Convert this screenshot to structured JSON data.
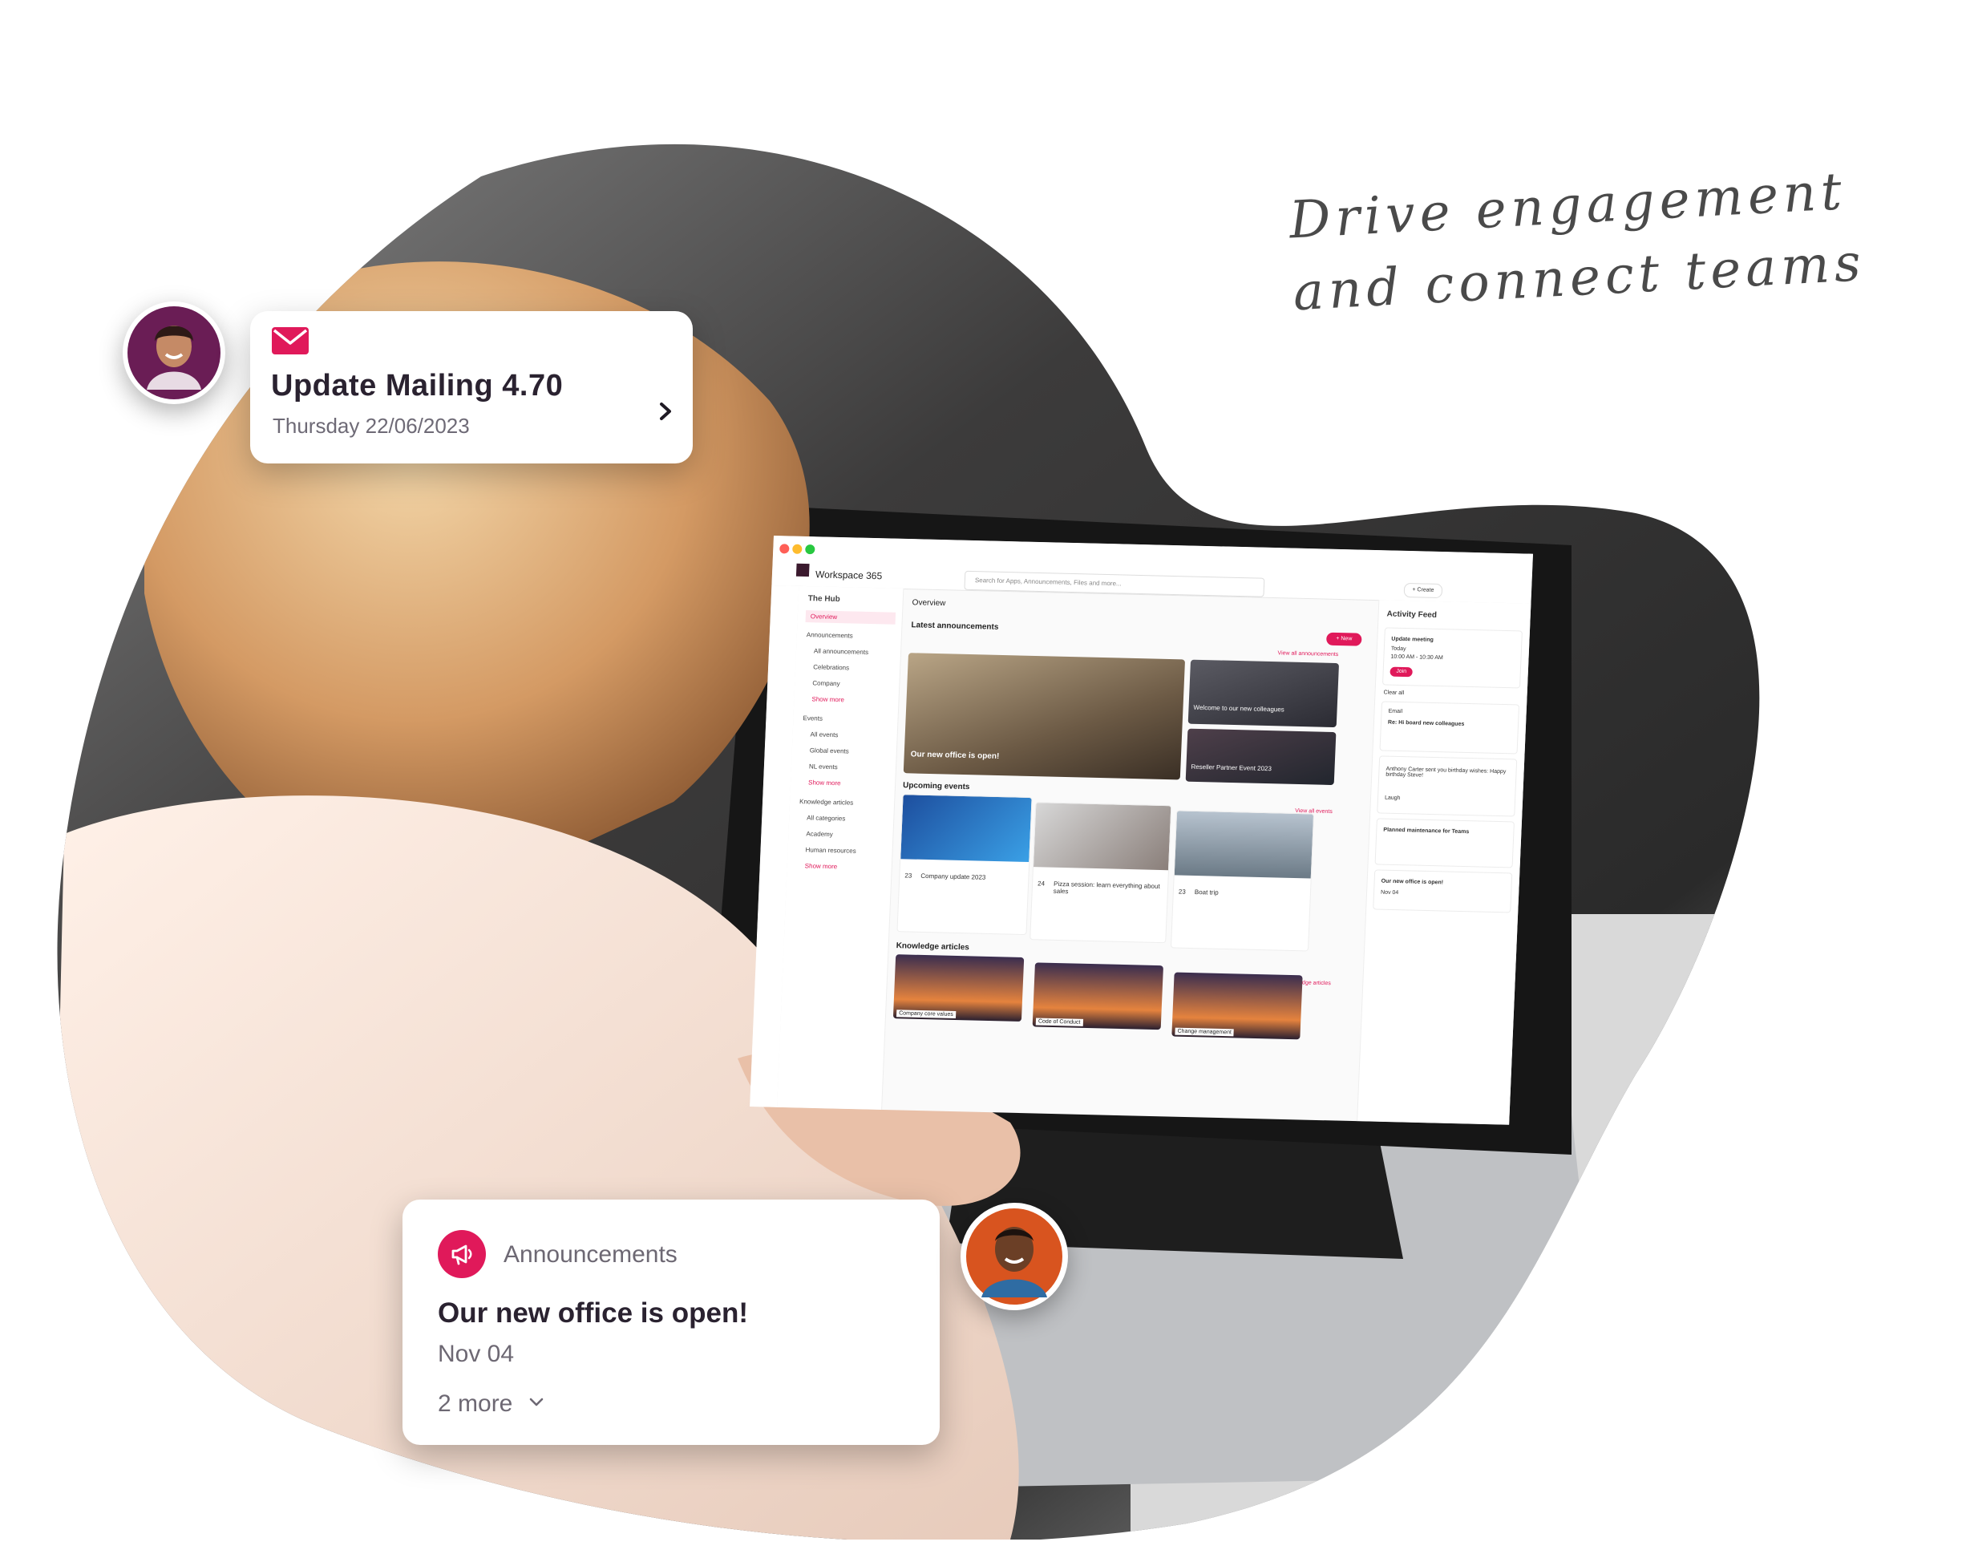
{
  "tagline": "Drive engagement and connect teams",
  "mailing_card": {
    "icon": "mail-icon",
    "title": "Update Mailing 4.70",
    "date": "Thursday 22/06/2023",
    "chevron_icon": "chevron-right-icon"
  },
  "announce_card": {
    "icon": "megaphone-icon",
    "category": "Announcements",
    "headline": "Our new office is open!",
    "date": "Nov 04",
    "more": "2 more"
  },
  "app": {
    "title": "Workspace 365",
    "search_placeholder": "Search for Apps, Announcements, Files and more...",
    "create": "+ Create",
    "nav": {
      "hub": "The Hub",
      "overview": "Overview",
      "announcements": "Announcements",
      "all_announcements": "All announcements",
      "celebrations": "Celebrations",
      "company": "Company",
      "show_more": "Show more",
      "events": "Events",
      "all_events": "All events",
      "global_events": "Global events",
      "nl_events": "NL events",
      "knowledge": "Knowledge articles",
      "all_categories": "All categories",
      "academy": "Academy",
      "human_resources": "Human resources"
    },
    "main": {
      "overview": "Overview",
      "latest": "Latest announcements",
      "new": "+ New",
      "view_all_ann": "View all announcements",
      "hero": "Our new office is open!",
      "welcome": "Welcome to our new colleagues",
      "partner": "Reseller Partner Event 2023",
      "upcoming": "Upcoming events",
      "view_all_events": "View all events",
      "events": [
        {
          "title": "Company update 2023",
          "day": "23"
        },
        {
          "title": "Pizza session: learn everything about sales",
          "day": "24"
        },
        {
          "title": "Boat trip",
          "day": "23"
        }
      ],
      "knowledge": "Knowledge articles",
      "view_all_knowledge": "View all knowledge articles",
      "articles": [
        "Company core values",
        "Code of Conduct",
        "Change management"
      ]
    },
    "feed": {
      "title": "Activity Feed",
      "meeting": "Update meeting",
      "meeting_when": "Today",
      "meeting_time": "10:00 AM - 10:30 AM",
      "join": "Join",
      "clear": "Clear all",
      "email": "Email",
      "email_subject": "Re: Hi board new colleagues",
      "birthday": "Anthony Carter sent you birthday wishes: Happy birthday Steve!",
      "laugh": "Laugh",
      "maintenance": "Planned maintenance for Teams",
      "ann": "Our new office is open!",
      "ann_date": "Nov 04"
    }
  },
  "colors": {
    "accent": "#e0195a",
    "card_text": "#2a2230",
    "muted": "#6d6873"
  }
}
